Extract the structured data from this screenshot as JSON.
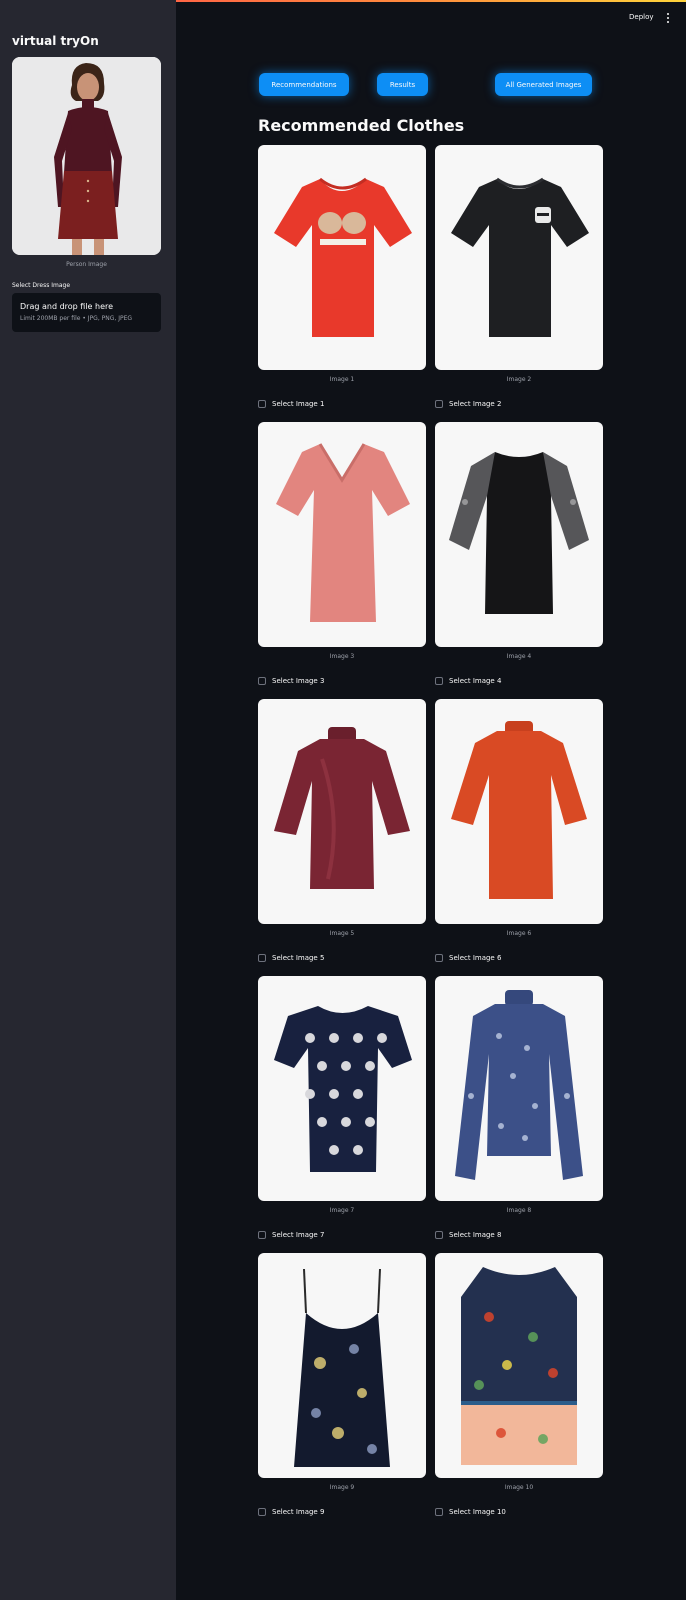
{
  "app": {
    "title": "virtual tryOn"
  },
  "topbar": {
    "deploy_label": "Deploy",
    "menu_icon": "kebab-menu-icon"
  },
  "sidebar": {
    "person_caption": "Person Image",
    "dress_label": "Select Dress Image",
    "uploader": {
      "title": "Drag and drop file here",
      "limit": "Limit 200MB per file • JPG, PNG, JPEG"
    }
  },
  "buttons": {
    "recommendations": "Recommendations",
    "results": "Results",
    "all_generated": "All Generated Images"
  },
  "section_title": "Recommended Clothes",
  "colors": {
    "accent": "#0d8ef5",
    "background": "#0e1117",
    "sidebar": "#262730"
  },
  "items": [
    {
      "caption": "Image 1",
      "checkbox_label": "Select Image 1",
      "garment": "red t-shirt with FIORUCCI print"
    },
    {
      "caption": "Image 2",
      "checkbox_label": "Select Image 2",
      "garment": "black t-shirt with face patch"
    },
    {
      "caption": "Image 3",
      "checkbox_label": "Select Image 3",
      "garment": "pink v-neck t-shirt"
    },
    {
      "caption": "Image 4",
      "checkbox_label": "Select Image 4",
      "garment": "black top with lace sleeves"
    },
    {
      "caption": "Image 5",
      "checkbox_label": "Select Image 5",
      "garment": "burgundy velvet mock-neck top"
    },
    {
      "caption": "Image 6",
      "checkbox_label": "Select Image 6",
      "garment": "orange knit top"
    },
    {
      "caption": "Image 7",
      "checkbox_label": "Select Image 7",
      "garment": "navy polka dot top"
    },
    {
      "caption": "Image 8",
      "checkbox_label": "Select Image 8",
      "garment": "blue floral long-sleeve top"
    },
    {
      "caption": "Image 9",
      "checkbox_label": "Select Image 9",
      "garment": "black floral camisole"
    },
    {
      "caption": "Image 10",
      "checkbox_label": "Select Image 10",
      "garment": "floral sleeveless blouse"
    }
  ]
}
